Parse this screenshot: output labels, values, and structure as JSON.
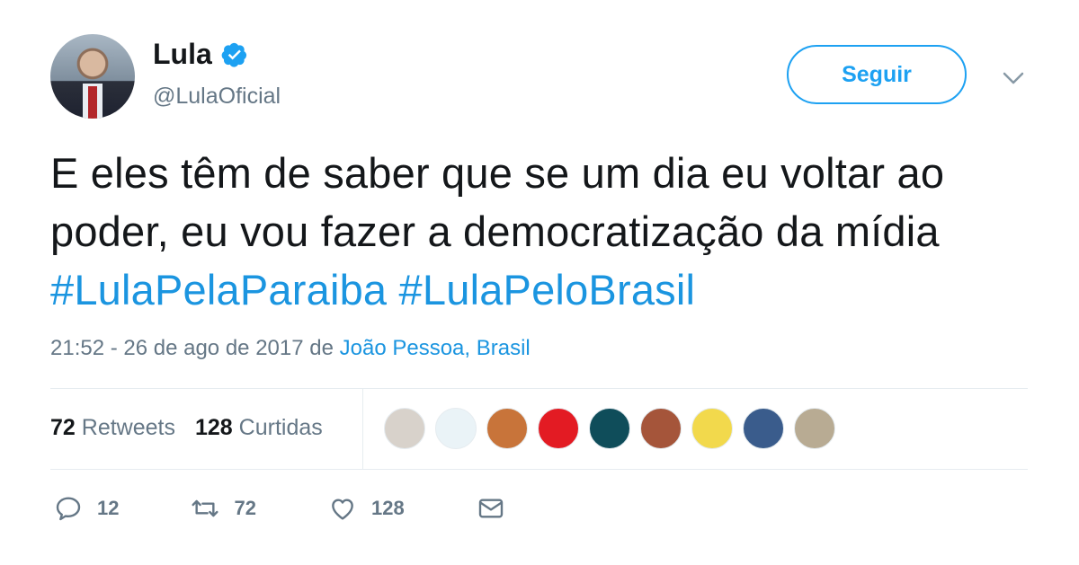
{
  "tweet": {
    "author_name": "Lula",
    "handle": "@LulaOficial",
    "follow_label": "Seguir",
    "text_parts": [
      {
        "text": "E eles têm de saber que se um dia eu voltar ao poder, eu vou fazer a democratização da mídia "
      },
      {
        "hashtag": "#LulaPelaParaiba"
      },
      {
        "text": " "
      },
      {
        "hashtag": "#LulaPeloBrasil"
      }
    ],
    "timestamp": "21:52 - 26 de ago de 2017",
    "from_word": "de",
    "place": "João Pessoa, Brasil"
  },
  "stats": {
    "retweets_count": "72",
    "retweets_label": "Retweets",
    "likes_count": "128",
    "likes_label": "Curtidas"
  },
  "liker_avatars": [
    {
      "color": "#d8d2cb"
    },
    {
      "color": "#eaf3f7"
    },
    {
      "color": "#c8743a"
    },
    {
      "color": "#e31b23"
    },
    {
      "color": "#0f4d5a"
    },
    {
      "color": "#a5553a"
    },
    {
      "color": "#f2d94c"
    },
    {
      "color": "#3a5c8c"
    },
    {
      "color": "#b8ab93"
    }
  ],
  "actions": {
    "reply_count": "12",
    "retweet_count": "72",
    "like_count": "128"
  },
  "colors": {
    "accent": "#1da1f2",
    "link": "#1b95e0",
    "muted": "#657786"
  }
}
